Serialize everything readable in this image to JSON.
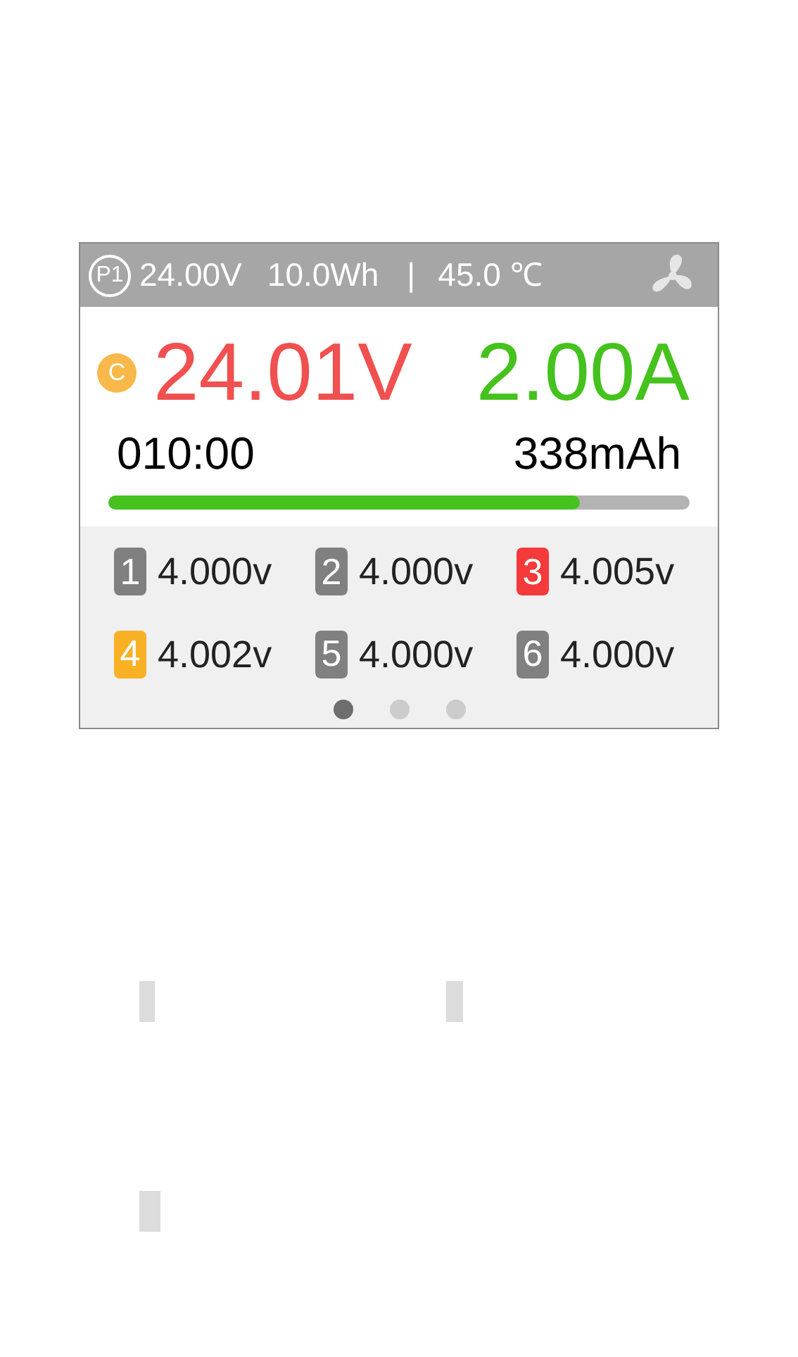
{
  "header": {
    "profile": "P1",
    "voltage": "24.00V",
    "energy": "10.0Wh",
    "separator": "|",
    "temperature": "45.0 ℃"
  },
  "main": {
    "mode": "C",
    "voltage": "24.01V",
    "current": "2.00A",
    "time": "010:00",
    "capacity": "338mAh",
    "level": 0.81
  },
  "cells": [
    {
      "index": "1",
      "voltage": "4.000v",
      "color": "#808080"
    },
    {
      "index": "2",
      "voltage": "4.000v",
      "color": "#808080"
    },
    {
      "index": "3",
      "voltage": "4.005v",
      "color": "#f43a3a"
    },
    {
      "index": "4",
      "voltage": "4.002v",
      "color": "#f8b125"
    },
    {
      "index": "5",
      "voltage": "4.000v",
      "color": "#808080"
    },
    {
      "index": "6",
      "voltage": "4.000v",
      "color": "#808080"
    }
  ],
  "pages": [
    {
      "selected": true
    },
    {
      "selected": false
    },
    {
      "selected": false
    }
  ]
}
